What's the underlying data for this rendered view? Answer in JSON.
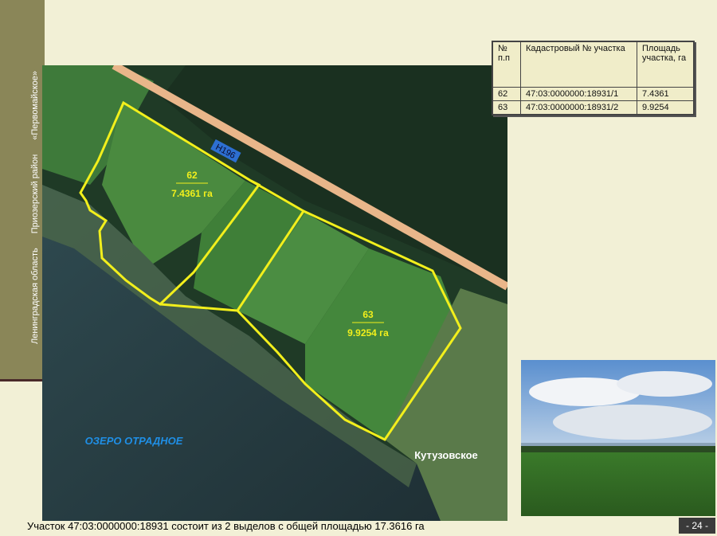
{
  "sidebar": {
    "region": "Ленинградская область",
    "district": "Приозерский район",
    "settlement": "«Первомайское»"
  },
  "map": {
    "road_label": "Н196",
    "lake_label": "ОЗЕРО ОТРАДНОЕ",
    "village_label": "Кутузовское",
    "parcels": [
      {
        "number": "62",
        "area": "7.4361 га"
      },
      {
        "number": "63",
        "area": "9.9254 га"
      }
    ],
    "boundary_color": "#f2ef1c"
  },
  "table": {
    "headers": [
      "№ п.п",
      "Кадастровый № участка",
      "Площадь участка, га"
    ],
    "rows": [
      [
        "62",
        "47:03:0000000:18931/1",
        "7.4361"
      ],
      [
        "63",
        "47:03:0000000:18931/2",
        "9.9254"
      ]
    ]
  },
  "caption": "Участок 47:03:0000000:18931 состоит из 2 выделов с общей площадью 17.3616 га",
  "page_number": "- 24 -"
}
